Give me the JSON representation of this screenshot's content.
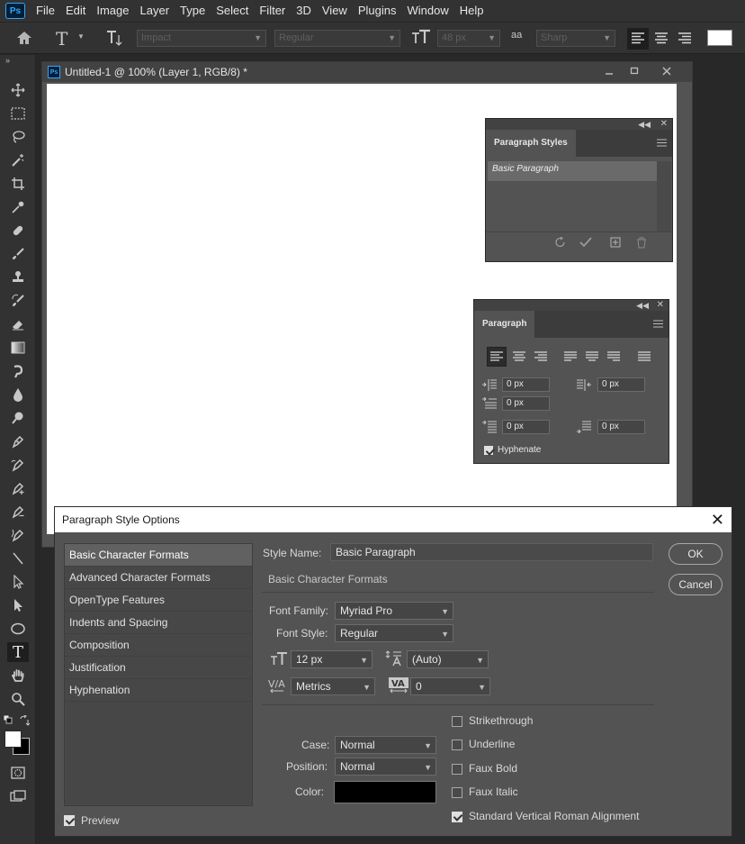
{
  "app": {
    "logo": "Ps"
  },
  "menu": [
    "File",
    "Edit",
    "Image",
    "Layer",
    "Type",
    "Select",
    "Filter",
    "3D",
    "View",
    "Plugins",
    "Window",
    "Help"
  ],
  "options_bar": {
    "font_family": "Impact",
    "font_style": "Regular",
    "font_size": "48 px",
    "antialias_icon": "aa",
    "antialias": "Sharp",
    "text_color": "#ffffff"
  },
  "document": {
    "title": "Untitled-1 @ 100% (Layer 1, RGB/8) *",
    "logo": "Ps"
  },
  "paragraph_styles_panel": {
    "tab": "Paragraph Styles",
    "items": [
      "Basic Paragraph"
    ]
  },
  "paragraph_panel": {
    "tab": "Paragraph",
    "indent_left": "0 px",
    "indent_right": "0 px",
    "indent_first": "0 px",
    "space_before": "0 px",
    "space_after": "0 px",
    "hyphenate_label": "Hyphenate",
    "hyphenate_checked": true
  },
  "dialog": {
    "title": "Paragraph Style Options",
    "categories": [
      "Basic Character Formats",
      "Advanced Character Formats",
      "OpenType Features",
      "Indents and Spacing",
      "Composition",
      "Justification",
      "Hyphenation"
    ],
    "selected_category": "Basic Character Formats",
    "style_name_label": "Style Name:",
    "style_name": "Basic Paragraph",
    "section_title": "Basic Character Formats",
    "font_family_label": "Font Family:",
    "font_family": "Myriad Pro",
    "font_style_label": "Font Style:",
    "font_style": "Regular",
    "font_size": "12 px",
    "leading": "(Auto)",
    "kerning": "Metrics",
    "tracking": "0",
    "case_label": "Case:",
    "case": "Normal",
    "position_label": "Position:",
    "position": "Normal",
    "color_label": "Color:",
    "color": "#000000",
    "checks": [
      {
        "label": "Strikethrough",
        "checked": false
      },
      {
        "label": "Underline",
        "checked": false
      },
      {
        "label": "Faux Bold",
        "checked": false
      },
      {
        "label": "Faux Italic",
        "checked": false
      },
      {
        "label": "Standard Vertical Roman Alignment",
        "checked": true
      }
    ],
    "preview_label": "Preview",
    "preview_checked": true,
    "ok_label": "OK",
    "cancel_label": "Cancel"
  }
}
